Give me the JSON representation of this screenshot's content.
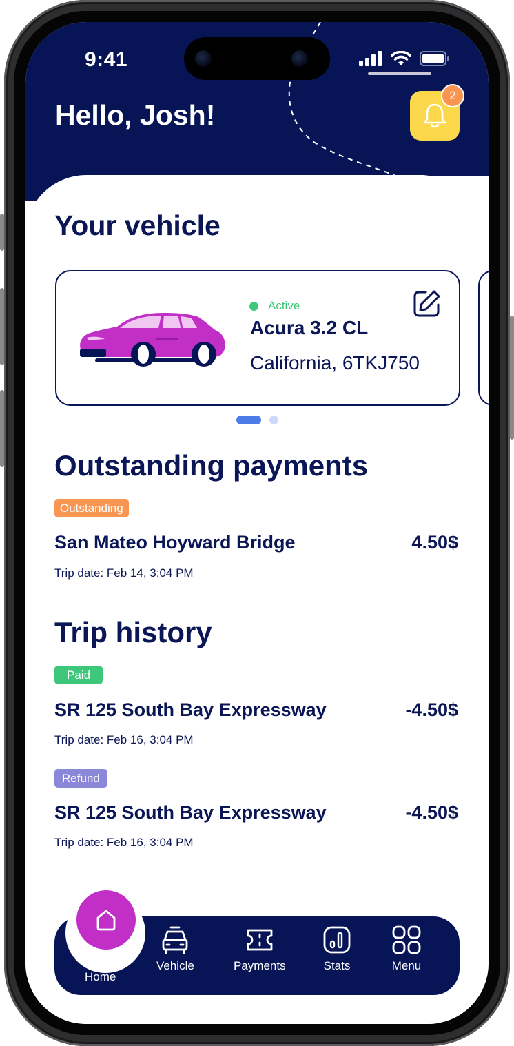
{
  "status_bar": {
    "time": "9:41"
  },
  "header": {
    "greeting": "Hello, Josh!",
    "notification_count": "2"
  },
  "vehicle_section": {
    "title": "Your vehicle",
    "vehicle": {
      "status": "Active",
      "name": "Acura 3.2 CL",
      "plate": "California, 6TKJ750",
      "car_color": "#c12fc7"
    },
    "carousel_pages": 2,
    "carousel_active_index": 0
  },
  "outstanding_section": {
    "title": "Outstanding payments",
    "items": [
      {
        "tag": "Outstanding",
        "tag_color": "#f89550",
        "title": "San Mateo Hoyward Bridge",
        "amount": "4.50$",
        "date": "Trip date: Feb 14, 3:04 PM"
      }
    ]
  },
  "trip_section": {
    "title": "Trip history",
    "items": [
      {
        "tag": "Paid",
        "tag_color": "#3cc77a",
        "title": "SR 125 South Bay Expressway",
        "amount": "-4.50$",
        "date": "Trip date: Feb 16, 3:04 PM"
      },
      {
        "tag": "Refund",
        "tag_color": "#8b87d9",
        "title": "SR 125 South Bay Expressway",
        "amount": "-4.50$",
        "date": "Trip date: Feb 16, 3:04 PM"
      }
    ]
  },
  "bottom_nav": {
    "items": [
      {
        "label": "Home",
        "icon": "home-icon",
        "active": true
      },
      {
        "label": "Vehicle",
        "icon": "car-icon"
      },
      {
        "label": "Payments",
        "icon": "ticket-icon"
      },
      {
        "label": "Stats",
        "icon": "stats-icon"
      },
      {
        "label": "Menu",
        "icon": "menu-grid-icon"
      }
    ]
  },
  "colors": {
    "navy": "#071556",
    "accent_yellow": "#fbd84b",
    "accent_purple": "#c12fc7",
    "active_green": "#3cc77a"
  }
}
